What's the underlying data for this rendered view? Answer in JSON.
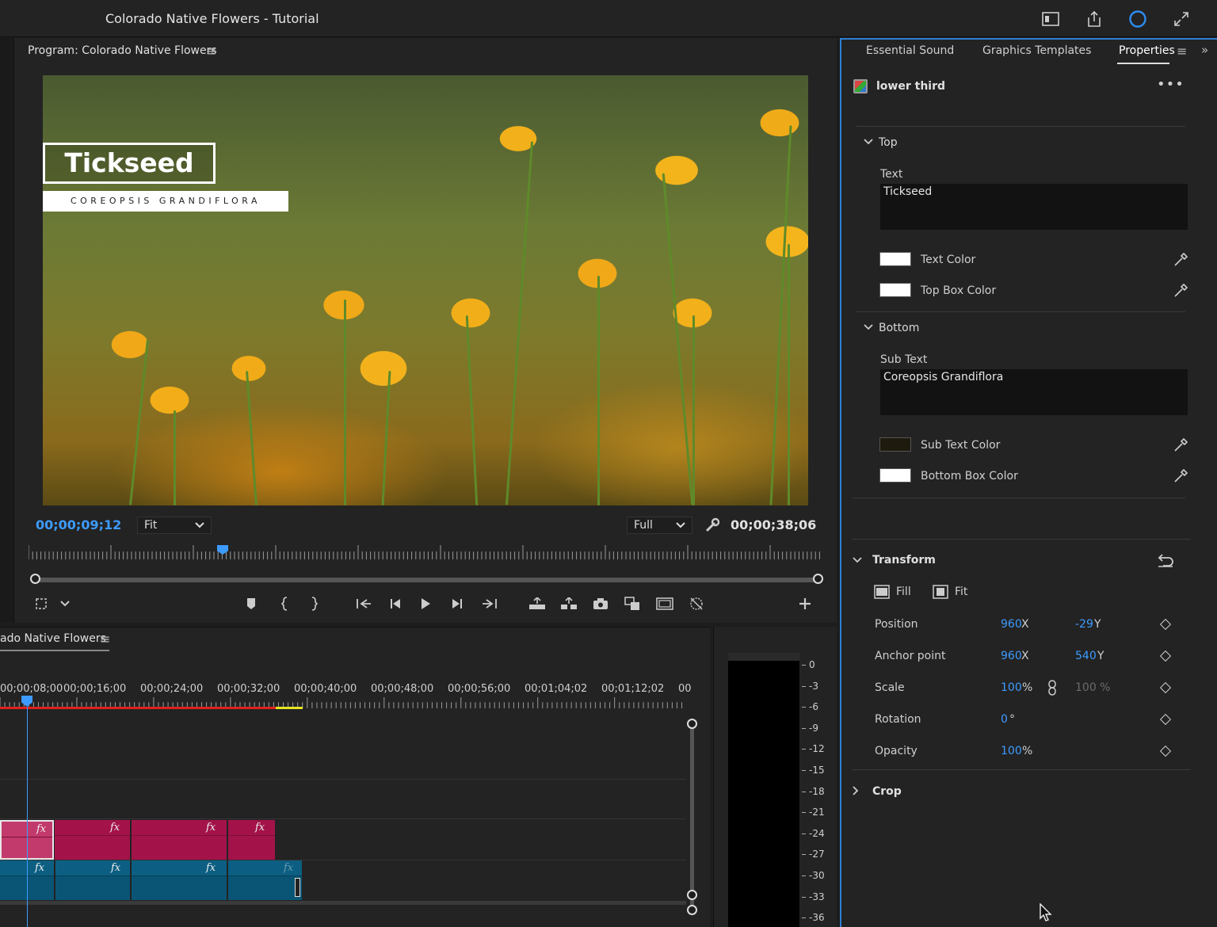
{
  "app": {
    "title": "Colorado Native Flowers - Tutorial"
  },
  "program": {
    "title": "Program: Colorado Native Flowers",
    "menu_icon": "≡",
    "lower_third": {
      "top_text": "Tickseed",
      "bottom_text": "COREOPSIS GRANDIFLORA"
    },
    "timecode_current": "00;00;09;12",
    "zoom": "Fit",
    "resolution": "Full",
    "timecode_duration": "00;00;38;06"
  },
  "timeline": {
    "title": "ado Native Flowers",
    "menu_icon": "≡",
    "labels": [
      "00;00;08;00",
      "00;00;16;00",
      "00;00;24;00",
      "00;00;32;00",
      "00;00;40;00",
      "00;00;48;00",
      "00;00;56;00",
      "00;01;04;02",
      "00;01;12;02",
      "00"
    ],
    "fx": "fx"
  },
  "meter": {
    "db": [
      "0",
      "-3",
      "-6",
      "-9",
      "-12",
      "-15",
      "-18",
      "-21",
      "-24",
      "-27",
      "-30",
      "-33",
      "-36"
    ]
  },
  "props": {
    "tabs": [
      "Essential Sound",
      "Graphics Templates",
      "Properties"
    ],
    "menu_icon": "≡",
    "more_icon": "»",
    "clip_name": "lower third",
    "clip_more": "•••",
    "top_section": {
      "title": "Top",
      "text_label": "Text",
      "text_value": "Tickseed",
      "text_color_label": "Text Color",
      "box_color_label": "Top Box Color",
      "text_color": "#ffffff",
      "box_color": "#ffffff"
    },
    "bottom_section": {
      "title": "Bottom",
      "text_label": "Sub Text",
      "text_value": "Coreopsis Grandiflora",
      "text_color_label": "Sub Text Color",
      "box_color_label": "Bottom Box Color",
      "text_color": "#1e1b0e",
      "box_color": "#ffffff"
    },
    "transform": {
      "title": "Transform",
      "fill_label": "Fill",
      "fit_label": "Fit",
      "position_label": "Position",
      "position_x": "960",
      "position_y": "-29",
      "anchor_label": "Anchor point",
      "anchor_x": "960",
      "anchor_y": "540",
      "scale_label": "Scale",
      "scale_value": "100",
      "scale_value2": "100 %",
      "rotation_label": "Rotation",
      "rotation_value": "0",
      "opacity_label": "Opacity",
      "opacity_value": "100",
      "x_unit": "X",
      "y_unit": "Y",
      "pct_unit": "%",
      "deg_unit": "°"
    },
    "crop": {
      "title": "Crop"
    }
  },
  "colors": {
    "accent": "#3d9bff",
    "video_clip": "#a3134a",
    "audio_clip": "#0a5575",
    "panel_focus": "#2d7fd4"
  }
}
